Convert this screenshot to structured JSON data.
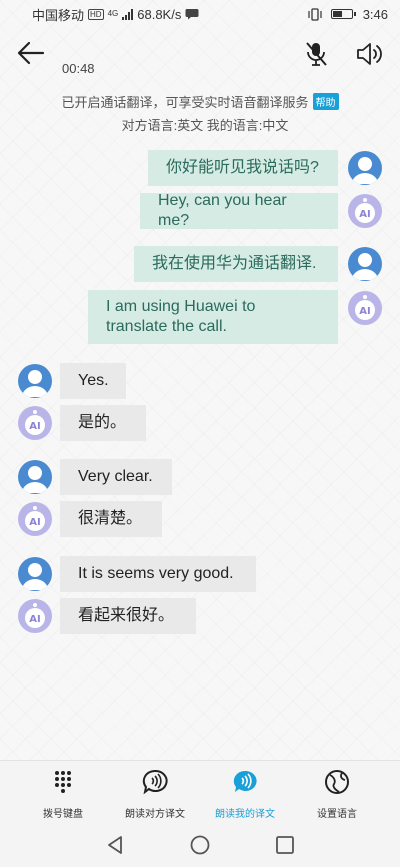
{
  "status_bar": {
    "carrier": "中国移动",
    "hd": "HD",
    "network": "4G",
    "speed": "68.8K/s",
    "time": "3:46"
  },
  "header": {
    "timer": "00:48"
  },
  "notice": {
    "text": "已开启通话翻译，可享受实时语音翻译服务",
    "help_label": "帮助",
    "languages": "对方语言:英文  我的语言:中文"
  },
  "messages": [
    {
      "side": "mine",
      "speaker": "person",
      "text": "你好能听见我说话吗?"
    },
    {
      "side": "mine",
      "speaker": "ai",
      "text": "Hey, can you hear me?"
    },
    {
      "side": "mine",
      "speaker": "person",
      "text": "我在使用华为通话翻译."
    },
    {
      "side": "mine",
      "speaker": "ai",
      "text": "I am using Huawei to translate the call."
    },
    {
      "side": "theirs",
      "speaker": "person",
      "text": "Yes."
    },
    {
      "side": "theirs",
      "speaker": "ai",
      "text": "是的。"
    },
    {
      "side": "theirs",
      "speaker": "person",
      "text": "Very clear."
    },
    {
      "side": "theirs",
      "speaker": "ai",
      "text": "很清楚。"
    },
    {
      "side": "theirs",
      "speaker": "person",
      "text": "It is seems very good."
    },
    {
      "side": "theirs",
      "speaker": "ai",
      "text": "看起来很好。"
    }
  ],
  "ai_avatar_label": "AI",
  "toolbar": {
    "dialpad": "拨号键盘",
    "read_other": "朗读对方译文",
    "read_mine": "朗读我的译文",
    "set_language": "设置语言"
  },
  "colors": {
    "accent": "#1aa0d8",
    "my_bubble": "#d5ebe3",
    "their_bubble": "#e9e9e9"
  }
}
